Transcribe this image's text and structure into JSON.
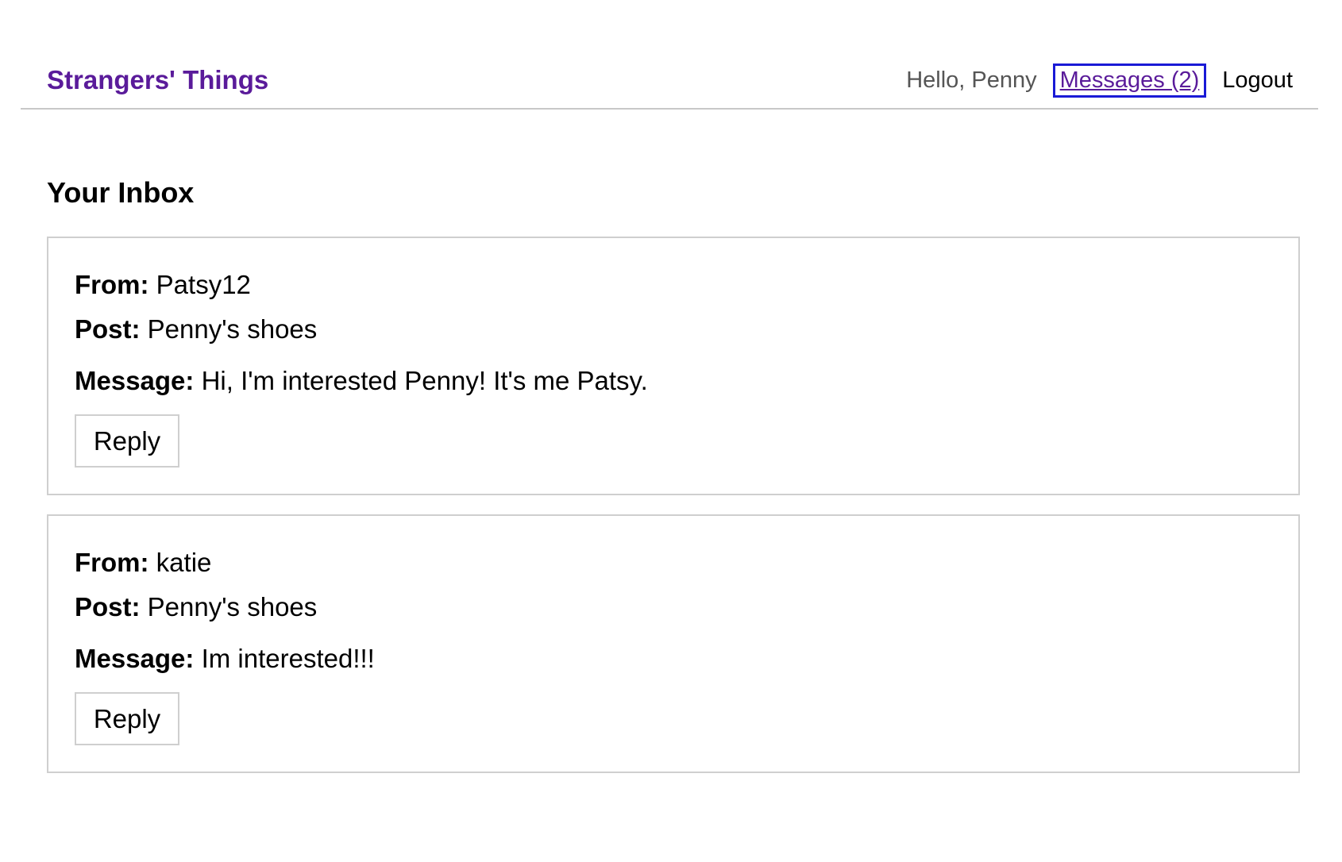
{
  "header": {
    "brand": "Strangers' Things",
    "greeting": "Hello, Penny",
    "messages_link": "Messages (2)",
    "logout": "Logout"
  },
  "page_title": "Your Inbox",
  "labels": {
    "from": "From:",
    "post": "Post:",
    "message": "Message:"
  },
  "messages": [
    {
      "from": "Patsy12",
      "post": "Penny's shoes",
      "message": "Hi, I'm interested Penny! It's me Patsy.",
      "reply_label": "Reply"
    },
    {
      "from": "katie",
      "post": "Penny's shoes",
      "message": "Im interested!!!",
      "reply_label": "Reply"
    }
  ],
  "colors": {
    "brand": "#5a1b9a",
    "focus_outline": "#1a1ad6",
    "border": "#cfcfcf"
  }
}
